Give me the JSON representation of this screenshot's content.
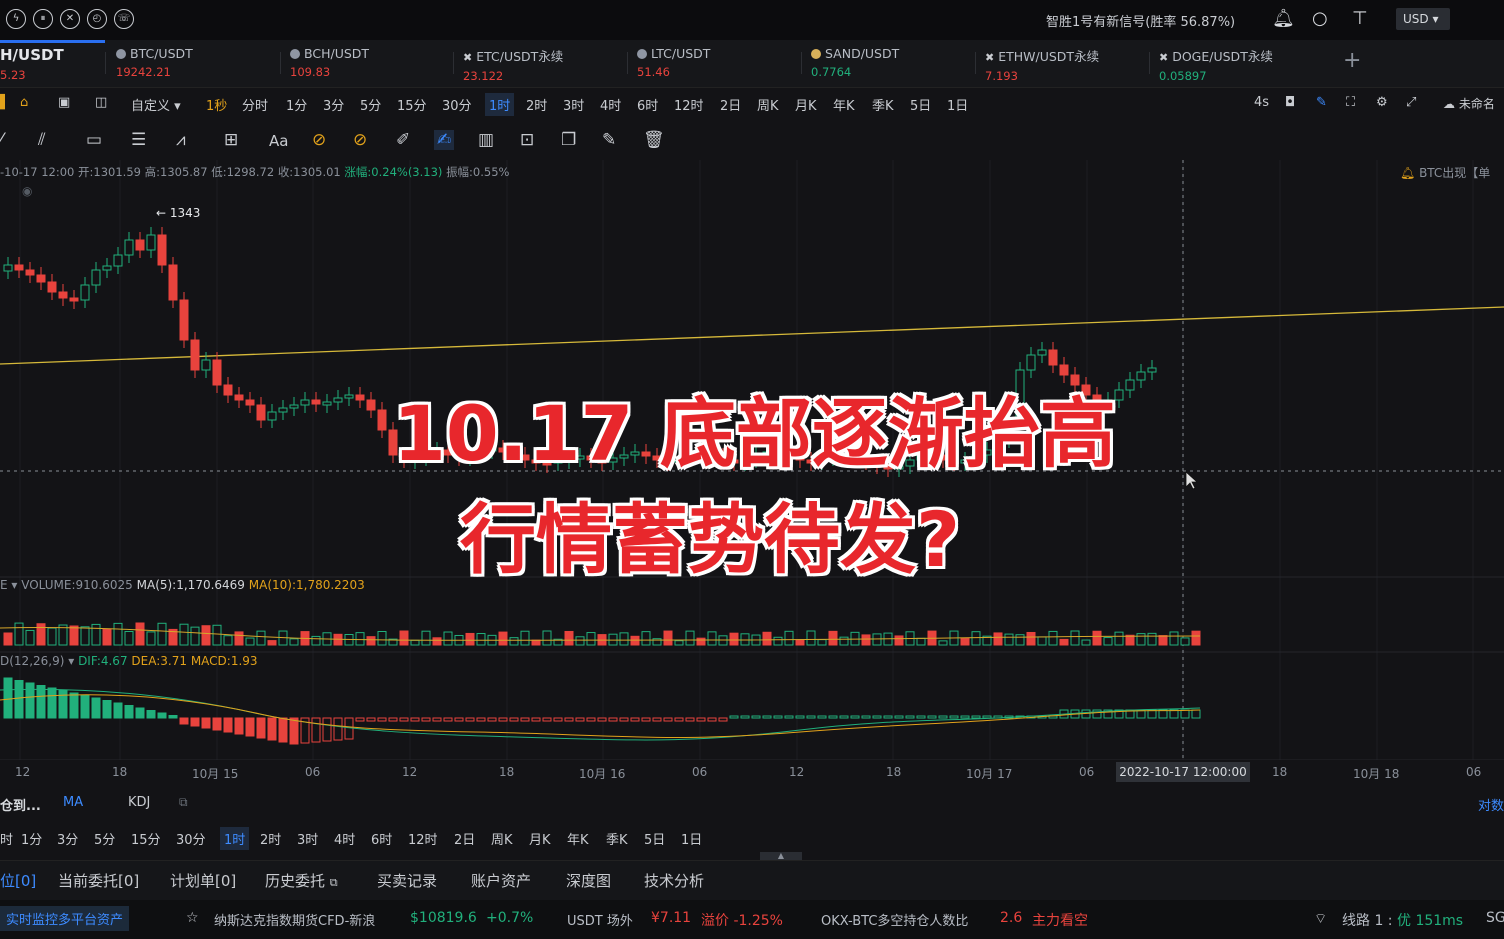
{
  "topbar": {
    "signal_text": "智胜1号有新信号(胜率 56.87%)",
    "currency": "USD"
  },
  "tabs": [
    {
      "name": "H/USDT",
      "price": "5.23",
      "price_color": "#e8433d"
    },
    {
      "name": "BTC/USDT",
      "price": "19242.21",
      "price_color": "#e8433d"
    },
    {
      "name": "BCH/USDT",
      "price": "109.83",
      "price_color": "#e8433d"
    },
    {
      "name": "ETC/USDT永续",
      "price": "23.122",
      "price_color": "#e8433d"
    },
    {
      "name": "LTC/USDT",
      "price": "51.46",
      "price_color": "#e8433d"
    },
    {
      "name": "SAND/USDT",
      "price": "0.7764",
      "price_color": "#21b07c"
    },
    {
      "name": "ETHW/USDT永续",
      "price": "7.193",
      "price_color": "#e8433d"
    },
    {
      "name": "DOGE/USDT永续",
      "price": "0.05897",
      "price_color": "#21b07c"
    }
  ],
  "intervals": {
    "custom": "自定义",
    "items": [
      "1秒",
      "分时",
      "1分",
      "3分",
      "5分",
      "15分",
      "30分",
      "1时",
      "2时",
      "3时",
      "4时",
      "6时",
      "12时",
      "2日",
      "周K",
      "月K",
      "年K",
      "季K",
      "5日",
      "1日"
    ],
    "selected": "1时",
    "right_refresh": "4s",
    "right_cloud": "未命名"
  },
  "tools": {
    "text_tool": "Aa"
  },
  "chart": {
    "ohlc_prefix": "-10-17 12:00",
    "open": "开:1301.59",
    "high": "高:1305.87",
    "low": "低:1298.72",
    "close": "收:1305.01",
    "change": "涨幅:0.24%(3.13)",
    "amplitude": "振幅:0.55%",
    "max_label": "← 1343",
    "alert": "BTC出现【单",
    "overlay_line1": "10.17 底部逐渐抬高",
    "overlay_line2": "行情蓄势待发?",
    "volume_label": "E ▾  VOLUME:910.6025",
    "volume_ma5": "MA(5):1,170.6469",
    "volume_ma10": "MA(10):1,780.2203",
    "macd_label": "D(12,26,9) ▾  ",
    "macd_dif": "DIF:4.67",
    "macd_dea": "DEA:3.71",
    "macd_macd": "MACD:1.93",
    "x_labels": [
      "12",
      "18",
      "10月 15",
      "06",
      "12",
      "18",
      "10月 16",
      "06",
      "12",
      "18",
      "10月 17",
      "06",
      "18",
      "10月 18",
      "06"
    ],
    "crosshair_time": "2022-10-17 12:00:00"
  },
  "indicator_tabs": {
    "first": "仓到...",
    "ma": "MA",
    "kdj": "KDJ",
    "right": "对数"
  },
  "intervals2": [
    "时",
    "1分",
    "3分",
    "5分",
    "15分",
    "30分",
    "1时",
    "2时",
    "3时",
    "4时",
    "6时",
    "12时",
    "2日",
    "周K",
    "月K",
    "年K",
    "季K",
    "5日",
    "1日"
  ],
  "order_tabs": [
    "位[0]",
    "当前委托[0]",
    "计划单[0]",
    "历史委托",
    "买卖记录",
    "账户资产",
    "深度图",
    "技术分析"
  ],
  "footer": {
    "monitor": "实时监控多平台资产",
    "nasdaq": "纳斯达克指数期货CFD-新浪",
    "nasdaq_val": "$10819.6",
    "nasdaq_chg": "+0.7%",
    "usdt": "USDT 场外",
    "usdt_val": "¥7.11",
    "usdt_premium": "溢价 -1.25%",
    "okx": "OKX-BTC多空持仓人数比",
    "okx_val": "2.6",
    "okx_view": "主力看空",
    "line": "线路 1 :",
    "line_q": "优 151ms",
    "sg": "SG"
  },
  "chart_data": {
    "type": "candlestick",
    "title": "10.17 底部逐渐抬高",
    "timeframe": "1时",
    "ohlc_last": {
      "open": 1301.59,
      "high": 1305.87,
      "low": 1298.72,
      "close": 1305.01
    }
  },
  "colors": {
    "up": "#21b07c",
    "down": "#e8433d",
    "accent": "#2a6ff0",
    "gold": "#e2a21b"
  }
}
